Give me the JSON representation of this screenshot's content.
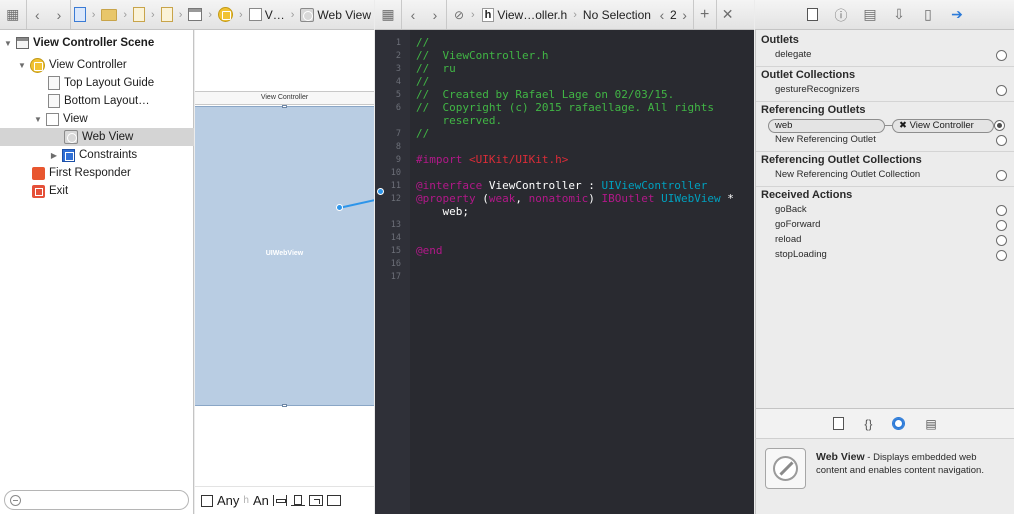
{
  "jump_bar_left": {
    "crumbs": [
      "V…",
      "Web View"
    ]
  },
  "jump_bar_mid": {
    "file_label": "View…oller.h",
    "selection": "No Selection",
    "counter": "2"
  },
  "navigator": {
    "items": [
      {
        "label": "View Controller Scene",
        "icon": "scene-icon"
      },
      {
        "label": "View Controller",
        "icon": "view-controller-icon"
      },
      {
        "label": "Top Layout Guide",
        "icon": "layout-guide-icon"
      },
      {
        "label": "Bottom Layout…",
        "icon": "layout-guide-icon"
      },
      {
        "label": "View",
        "icon": "view-icon"
      },
      {
        "label": "Web View",
        "icon": "web-view-icon"
      },
      {
        "label": "Constraints",
        "icon": "constraints-icon"
      },
      {
        "label": "First Responder",
        "icon": "first-responder-icon"
      },
      {
        "label": "Exit",
        "icon": "exit-icon"
      }
    ]
  },
  "canvas": {
    "scene_title": "View Controller",
    "web_view_label": "UIWebView",
    "size_class_left": "Any",
    "size_class_right": "An"
  },
  "editor": {
    "line_numbers": [
      "1",
      "2",
      "3",
      "4",
      "5",
      "6",
      "",
      "7",
      "8",
      "9",
      "10",
      "11",
      "12",
      "",
      "13",
      "14",
      "15",
      "16",
      "17"
    ],
    "lines": [
      [
        {
          "t": "//",
          "c": "comment"
        }
      ],
      [
        {
          "t": "//  ViewController.h",
          "c": "comment"
        }
      ],
      [
        {
          "t": "//  ru",
          "c": "comment"
        }
      ],
      [
        {
          "t": "//",
          "c": "comment"
        }
      ],
      [
        {
          "t": "//  Created by Rafael Lage on 02/03/15.",
          "c": "comment"
        }
      ],
      [
        {
          "t": "//  Copyright (c) 2015 rafaellage. All rights",
          "c": "comment"
        }
      ],
      [
        {
          "t": "    reserved.",
          "c": "comment"
        }
      ],
      [
        {
          "t": "//",
          "c": "comment"
        }
      ],
      [],
      [
        {
          "t": "#import ",
          "c": "kw"
        },
        {
          "t": "<UIKit/UIKit.h>",
          "c": "str"
        }
      ],
      [],
      [
        {
          "t": "@interface ",
          "c": "kw"
        },
        {
          "t": "ViewController",
          "c": "text"
        },
        {
          "t": " : ",
          "c": "text"
        },
        {
          "t": "UIViewController",
          "c": "type"
        }
      ],
      [
        {
          "t": "@property ",
          "c": "kw"
        },
        {
          "t": "(",
          "c": "text"
        },
        {
          "t": "weak",
          "c": "kw"
        },
        {
          "t": ", ",
          "c": "text"
        },
        {
          "t": "nonatomic",
          "c": "kw"
        },
        {
          "t": ") ",
          "c": "text"
        },
        {
          "t": "IBOutlet ",
          "c": "kw"
        },
        {
          "t": "UIWebView",
          "c": "type"
        },
        {
          "t": " *",
          "c": "text"
        }
      ],
      [
        {
          "t": "    web;",
          "c": "text"
        }
      ],
      [],
      [],
      [
        {
          "t": "@end",
          "c": "kw"
        }
      ],
      [],
      []
    ]
  },
  "inspector": {
    "outlets_title": "Outlets",
    "outlets": [
      "delegate"
    ],
    "outlet_collections_title": "Outlet Collections",
    "outlet_collections": [
      "gestureRecognizers"
    ],
    "referencing_outlets_title": "Referencing Outlets",
    "referencing_pill": "web",
    "referencing_target": "✖ View Controller",
    "new_referencing_outlet": "New Referencing Outlet",
    "referencing_collections_title": "Referencing Outlet Collections",
    "new_referencing_collection": "New Referencing Outlet Collection",
    "received_actions_title": "Received Actions",
    "received_actions": [
      "goBack",
      "goForward",
      "reload",
      "stopLoading"
    ]
  },
  "library": {
    "item_name": "Web View",
    "item_desc": " - Displays embedded web content and enables content navigation."
  },
  "colors": {
    "accent": "#2d95ea",
    "comment": "#41b645",
    "keyword": "#b21889",
    "string": "#db2c38",
    "type": "#00a0be",
    "editor_bg": "#292a30",
    "web_view_bg": "#b9cde3"
  }
}
